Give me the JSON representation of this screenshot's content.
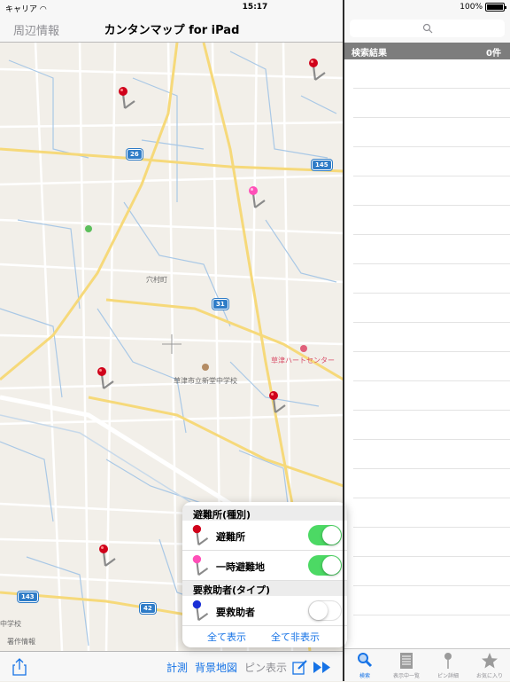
{
  "status": {
    "carrier": "キャリア",
    "time": "15:17",
    "battery": "100%"
  },
  "nav": {
    "back_label": "周辺情報",
    "title": "カンタンマップ for iPad"
  },
  "map": {
    "labels": {
      "town": "穴村町",
      "school": "草津市立新堂中学校",
      "hospital": "草津ハートセンター",
      "school2": "中学校",
      "office": "署作情報"
    },
    "route_shields": [
      "26",
      "145",
      "31",
      "143",
      "42"
    ]
  },
  "toolbar": {
    "measure": "計測",
    "background_map": "背景地図",
    "pin_display": "ピン表示"
  },
  "popover": {
    "section1": "避難所(種別)",
    "row1": "避難所",
    "row2": "一時避難地",
    "section2": "要救助者(タイプ)",
    "row3": "要救助者",
    "show_all": "全て表示",
    "hide_all": "全て非表示",
    "toggles": {
      "row1": true,
      "row2": true,
      "row3": false
    }
  },
  "right": {
    "results_title": "検索結果",
    "results_count": "0件",
    "tabs": [
      "検索",
      "表示中一覧",
      "ピン詳細",
      "お気に入り"
    ]
  },
  "colors": {
    "accent": "#1673e6",
    "toggle_on": "#4cd964",
    "pin_red": "#d0021b",
    "pin_pink": "#ff4fb8",
    "pin_blue": "#1a2fd6"
  }
}
